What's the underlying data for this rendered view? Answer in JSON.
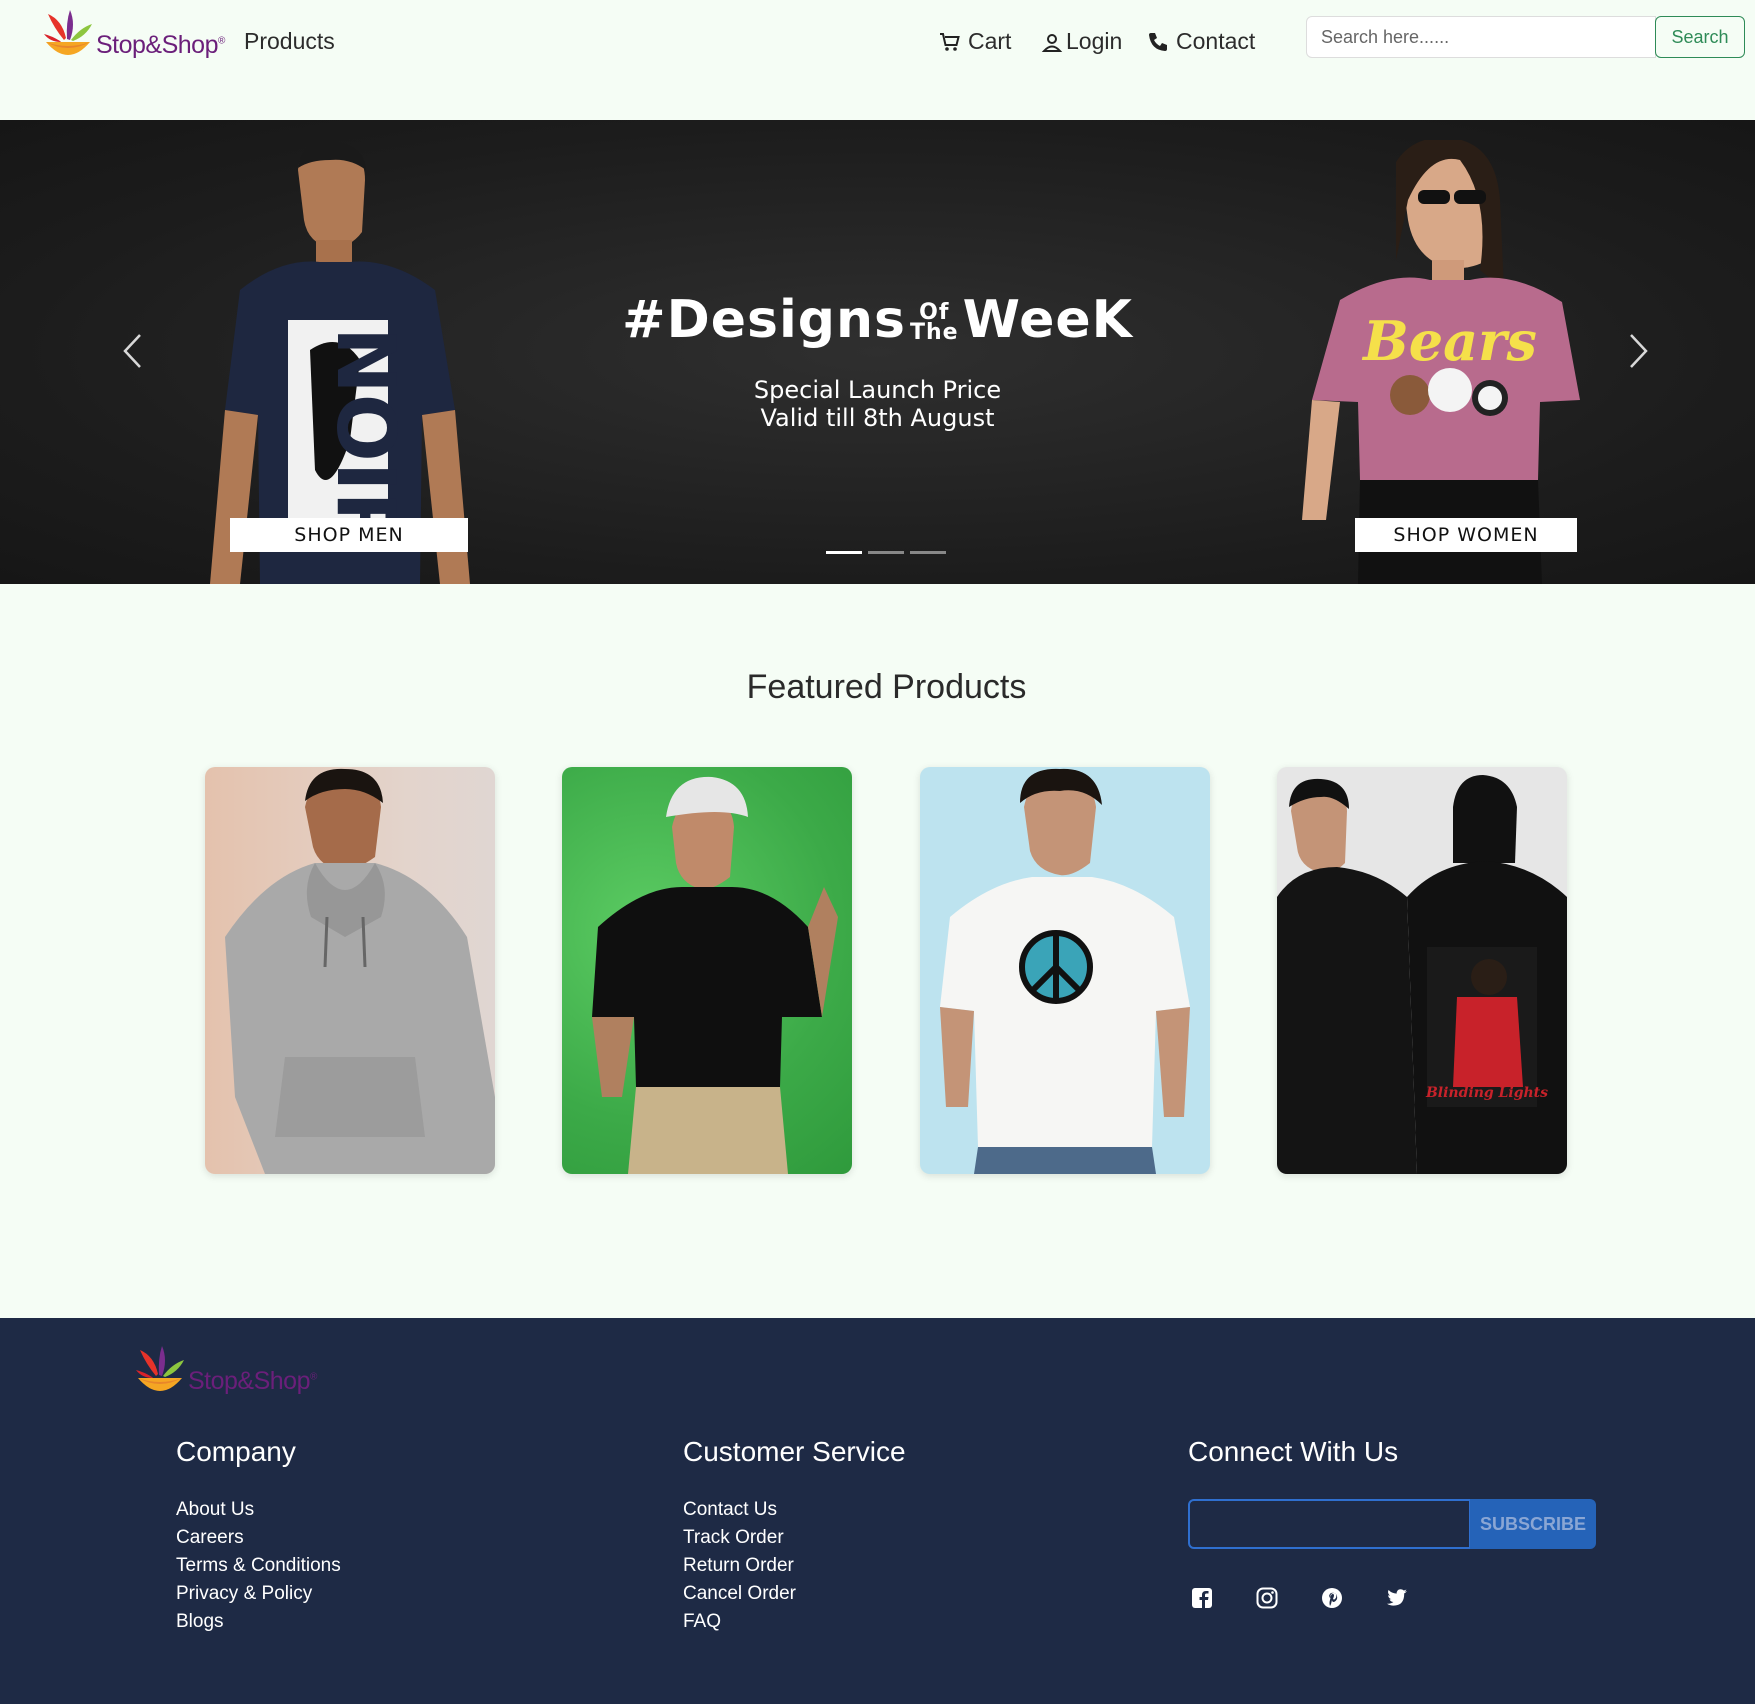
{
  "brand": {
    "name": "Stop&Shop",
    "reg_mark": "®"
  },
  "nav": {
    "products": "Products",
    "cart": "Cart",
    "login": "Login",
    "contact": "Contact",
    "search_placeholder": "Search here......",
    "search_button": "Search"
  },
  "hero": {
    "title_part1": "#Designs",
    "title_of": "Of",
    "title_the": "The",
    "title_part2": "WeeK",
    "subtitle_line1": "Special Launch Price",
    "subtitle_line2": "Valid till 8th August",
    "shop_men": "SHOP MEN",
    "shop_women": "SHOP WOMEN",
    "prev_icon": "chevron-left-icon",
    "next_icon": "chevron-right-icon",
    "slides": 3,
    "active_slide": 1
  },
  "featured": {
    "title": "Featured Products",
    "products": [
      {
        "image": "grey-hoodie-model",
        "bg": "#e2cfc3"
      },
      {
        "image": "black-tshirt-model",
        "bg": "#4bb35a"
      },
      {
        "image": "white-peace-tshirt-model",
        "bg": "#bde3ef"
      },
      {
        "image": "black-graphic-hoodie-models",
        "bg": "#e6e6e6"
      }
    ]
  },
  "footer": {
    "company": {
      "title": "Company",
      "links": [
        "About Us",
        "Careers",
        "Terms & Conditions",
        "Privacy & Policy",
        "Blogs"
      ]
    },
    "service": {
      "title": "Customer Service",
      "links": [
        "Contact Us",
        "Track Order",
        "Return Order",
        "Cancel Order",
        "FAQ"
      ]
    },
    "connect": {
      "title": "Connect With Us",
      "subscribe": "SUBSCRIBE",
      "social": [
        "facebook-icon",
        "instagram-icon",
        "pinterest-icon",
        "twitter-icon"
      ]
    }
  },
  "colors": {
    "page_bg": "#f5fdf5",
    "footer_bg": "#1e2a45",
    "accent_green": "#2e8b57",
    "brand_purple": "#6b1f7a",
    "subscribe_blue": "#2563b8"
  }
}
